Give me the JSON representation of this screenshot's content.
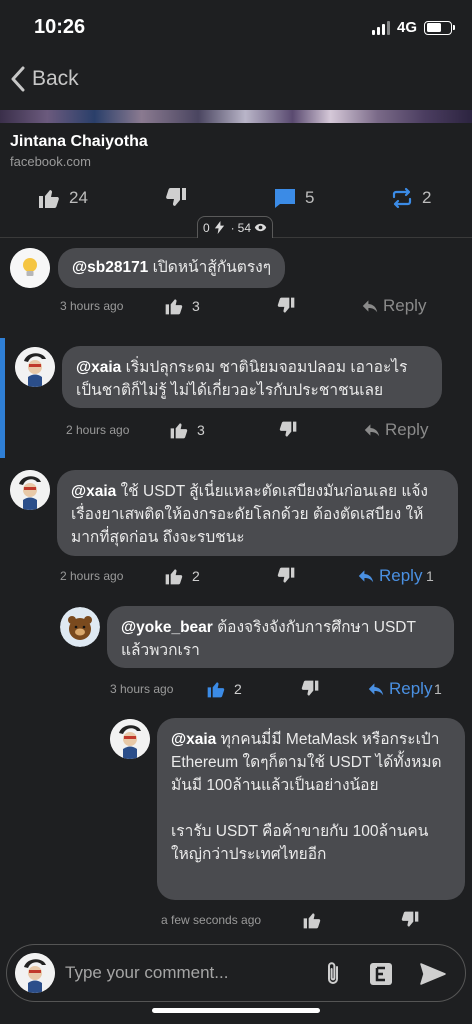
{
  "status": {
    "time": "10:26",
    "network": "4G"
  },
  "nav": {
    "back_label": "Back"
  },
  "source": {
    "title": "Jintana Chaiyotha",
    "domain": "facebook.com"
  },
  "actions": {
    "likes": "24",
    "comments": "5",
    "reposts": "2"
  },
  "views": {
    "left": "0",
    "count": "54"
  },
  "comments": [
    {
      "handle": "@sb28171",
      "text": " เปิดหน้าสู้กันตรงๆ",
      "time": "3 hours ago",
      "likes": "3",
      "reply_label": "Reply",
      "replies": ""
    },
    {
      "handle": "@xaia",
      "text": " เริ่มปลุกระดม ชาตินิยมจอมปลอม เอาอะไรเป็นชาติก็ไม่รู้ ไม่ได้เกี่ยวอะไรกับประชาชนเลย",
      "time": "2 hours ago",
      "likes": "3",
      "reply_label": "Reply",
      "replies": ""
    },
    {
      "handle": "@xaia",
      "text": " ใช้ USDT สู้เนี่ยแหละตัดเสบียงมันก่อนเลย แจ้งเรื่องยาเสพติดให้องกรอะดัยโลกด้วย ต้องตัดเสบียง ให้มากที่สุดก่อน ถึงจะรบชนะ",
      "time": "2 hours ago",
      "likes": "2",
      "reply_label": "Reply",
      "replies": "1"
    },
    {
      "handle": "@yoke_bear",
      "text": " ต้องจริงจังกับการศึกษา USDT แล้วพวกเรา",
      "time": "3 hours ago",
      "likes": "2",
      "reply_label": "Reply",
      "replies": "1"
    },
    {
      "handle": "@xaia",
      "text": " ทุกคนมี่มี MetaMask หรือกระเป๋า Ethereum ใดๆก็ตามใช้ USDT ได้ทั้งหมด มันมี 100ล้านแล้วเป็นอย่างน้อย",
      "text2": "เรารับ USDT คือค้าขายกับ 100ล้านคนใหญ่กว่าประเทศไทยอีก",
      "time": "a few seconds ago",
      "likes": "",
      "reply_label": "",
      "replies": ""
    }
  ],
  "composer": {
    "placeholder": "Type your comment..."
  },
  "colors": {
    "accent": "#4a90e2",
    "background": "#1e1f21",
    "bubble": "#4a4b4f"
  },
  "icons": [
    "back-chevron-icon",
    "thumb-up-icon",
    "thumb-down-icon",
    "comment-icon",
    "repost-icon",
    "bolt-icon",
    "eye-icon",
    "reply-arrow-icon",
    "paperclip-icon",
    "editor-icon",
    "send-icon"
  ]
}
